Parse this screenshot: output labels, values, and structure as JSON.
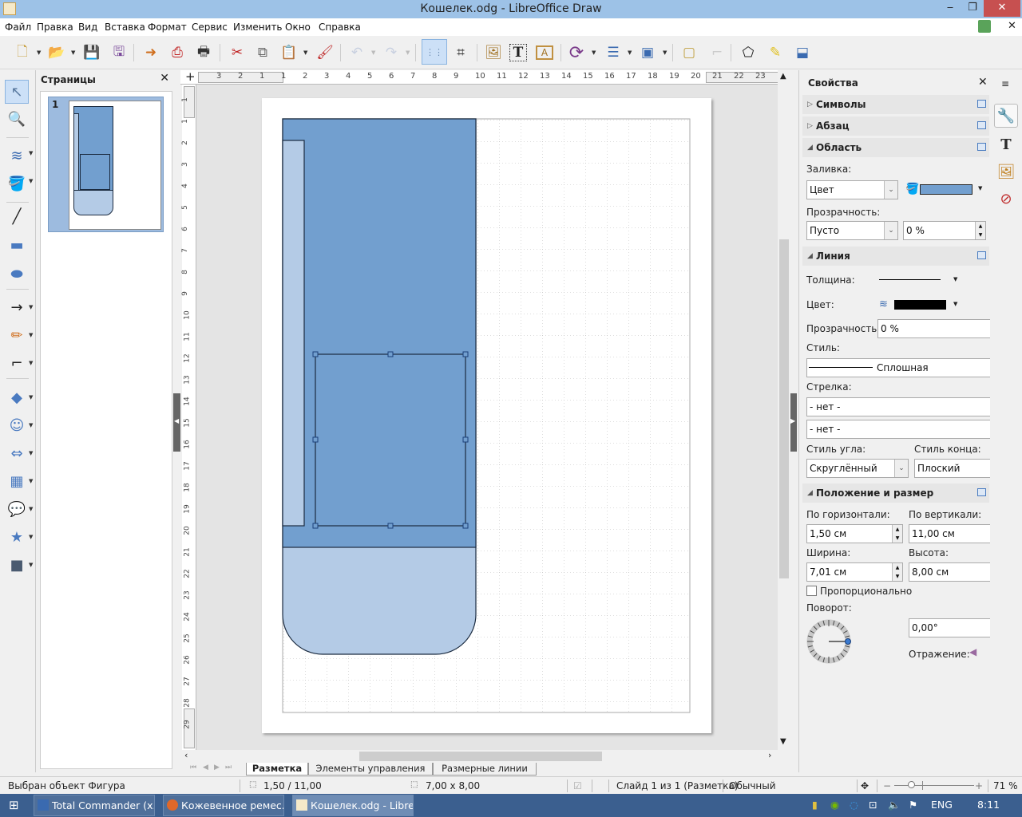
{
  "window": {
    "title": "Кошелек.odg - LibreOffice Draw",
    "minimize": "‒",
    "restore": "❐",
    "close": "✕"
  },
  "menu": [
    "Файл",
    "Правка",
    "Вид",
    "Вставка",
    "Формат",
    "Сервис",
    "Изменить",
    "Окно",
    "Справка"
  ],
  "menu_extra": {
    "update_icon": "download-update-icon",
    "close_doc": "✕"
  },
  "toolbar": [
    {
      "name": "new-document",
      "glyph": "🗋"
    },
    {
      "name": "open",
      "glyph": "📂"
    },
    {
      "name": "save",
      "glyph": "💾"
    },
    {
      "name": "save-as",
      "glyph": "🖫"
    },
    {
      "name": "export",
      "glyph": "➜"
    },
    {
      "name": "export-pdf",
      "glyph": "⎙"
    },
    {
      "name": "print",
      "glyph": "🖶"
    },
    {
      "name": "cut",
      "glyph": "✂"
    },
    {
      "name": "copy",
      "glyph": "⧉"
    },
    {
      "name": "paste",
      "glyph": "📋"
    },
    {
      "name": "clone-formatting",
      "glyph": "🖌"
    },
    {
      "name": "undo",
      "glyph": "↶"
    },
    {
      "name": "redo",
      "glyph": "↷"
    },
    {
      "name": "grid",
      "glyph": "⋮⋮"
    },
    {
      "name": "helplines",
      "glyph": "⌗"
    },
    {
      "name": "image",
      "glyph": "🖼"
    },
    {
      "name": "textbox",
      "glyph": "T"
    },
    {
      "name": "fontwork",
      "glyph": "A"
    },
    {
      "name": "rotate",
      "glyph": "⟳"
    },
    {
      "name": "align",
      "glyph": "☰"
    },
    {
      "name": "arrange",
      "glyph": "▣"
    },
    {
      "name": "shadow",
      "glyph": "▢"
    },
    {
      "name": "crop",
      "glyph": "⌐"
    },
    {
      "name": "points",
      "glyph": "⬠"
    },
    {
      "name": "glue-points",
      "glyph": "✎"
    },
    {
      "name": "toggle-extrusion",
      "glyph": "⬓"
    }
  ],
  "left_tools": [
    {
      "name": "select",
      "glyph": "↖"
    },
    {
      "name": "zoom",
      "glyph": "🔍"
    },
    {
      "name": "line-color",
      "glyph": "≋"
    },
    {
      "name": "fill-color",
      "glyph": "🪣"
    },
    {
      "name": "line",
      "glyph": "╱"
    },
    {
      "name": "rectangle",
      "glyph": "▬"
    },
    {
      "name": "ellipse",
      "glyph": "⬬"
    },
    {
      "name": "arrow-line",
      "glyph": "→"
    },
    {
      "name": "curve",
      "glyph": "✏"
    },
    {
      "name": "connector",
      "glyph": "⌐"
    },
    {
      "name": "basic-shapes",
      "glyph": "◆"
    },
    {
      "name": "symbol-shapes",
      "glyph": "☺"
    },
    {
      "name": "block-arrows",
      "glyph": "⇔"
    },
    {
      "name": "flowchart",
      "glyph": "▦"
    },
    {
      "name": "callouts",
      "glyph": "💬"
    },
    {
      "name": "stars",
      "glyph": "★"
    },
    {
      "name": "3d-objects",
      "glyph": "■"
    }
  ],
  "pages_panel": {
    "title": "Страницы",
    "close": "✕",
    "pages": [
      {
        "number": "1"
      }
    ]
  },
  "rulers": {
    "horizontal": [
      "3",
      "2",
      "1",
      "1",
      "2",
      "3",
      "4",
      "5",
      "6",
      "7",
      "8",
      "9",
      "10",
      "11",
      "12",
      "13",
      "14",
      "15",
      "16",
      "17",
      "18",
      "19",
      "20",
      "21",
      "22",
      "23"
    ],
    "vertical": [
      "1",
      "1",
      "2",
      "3",
      "4",
      "5",
      "6",
      "7",
      "8",
      "9",
      "10",
      "11",
      "12",
      "13",
      "14",
      "15",
      "16",
      "17",
      "18",
      "19",
      "20",
      "21",
      "22",
      "23",
      "24",
      "25",
      "26",
      "27",
      "28",
      "29"
    ]
  },
  "drawing": {
    "colors": {
      "dark_fill": "#729fcf",
      "light_fill": "#b4cbe6",
      "outline": "#1b2b40"
    },
    "selected_shape": {
      "x_cm": 1.5,
      "y_cm": 11.0,
      "width_cm": 7.01,
      "height_cm": 8.0
    }
  },
  "layer_tabs": [
    "Разметка",
    "Элементы управления",
    "Размерные линии"
  ],
  "sidebar": {
    "title": "Свойства",
    "close": "✕",
    "sections": {
      "symbols": "Символы",
      "paragraph": "Абзац",
      "area": "Область",
      "line": "Линия",
      "position": "Положение и размер"
    },
    "area": {
      "fill_label": "Заливка:",
      "fill_value": "Цвет",
      "fill_color": "#729fcf",
      "transparency_label": "Прозрачность:",
      "transparency_mode": "Пусто",
      "transparency_value": "0 %"
    },
    "line": {
      "width_label": "Толщина:",
      "color_label": "Цвет:",
      "color": "#000000",
      "transparency_label": "Прозрачность:",
      "transparency_value": "0 %",
      "style_label": "Стиль:",
      "style_value": "Сплошная",
      "arrow_label": "Стрелка:",
      "arrow_start": "- нет -",
      "arrow_end": "- нет -",
      "corner_label": "Стиль угла:",
      "corner_value": "Скруглённый",
      "cap_label": "Стиль конца:",
      "cap_value": "Плоский"
    },
    "position": {
      "h_label": "По горизонтали:",
      "h_value": "1,50 см",
      "v_label": "По вертикали:",
      "v_value": "11,00 см",
      "w_label": "Ширина:",
      "w_value": "7,01 см",
      "height_label": "Высота:",
      "height_value": "8,00 см",
      "proportional_label": "Пропорционально",
      "proportional_checked": false,
      "rotation_label": "Поворот:",
      "rotation_value": "0,00°",
      "flip_label": "Отражение:"
    }
  },
  "deck_tabs": [
    "properties",
    "styles",
    "gallery",
    "navigator"
  ],
  "statusbar": {
    "selection": "Выбран объект Фигура",
    "position": "1,50 / 11,00",
    "size": "7,00 x 8,00",
    "slide": "Слайд 1 из 1 (Разметка)",
    "master": "Обычный",
    "zoom": "71 %",
    "zoom_percent": 71
  },
  "taskbar": {
    "tasks": [
      "Total Commander (x...",
      "Кожевенное ремес...",
      "Кошелек.odg - Libre..."
    ],
    "lang": "ENG",
    "time": "8:11"
  }
}
